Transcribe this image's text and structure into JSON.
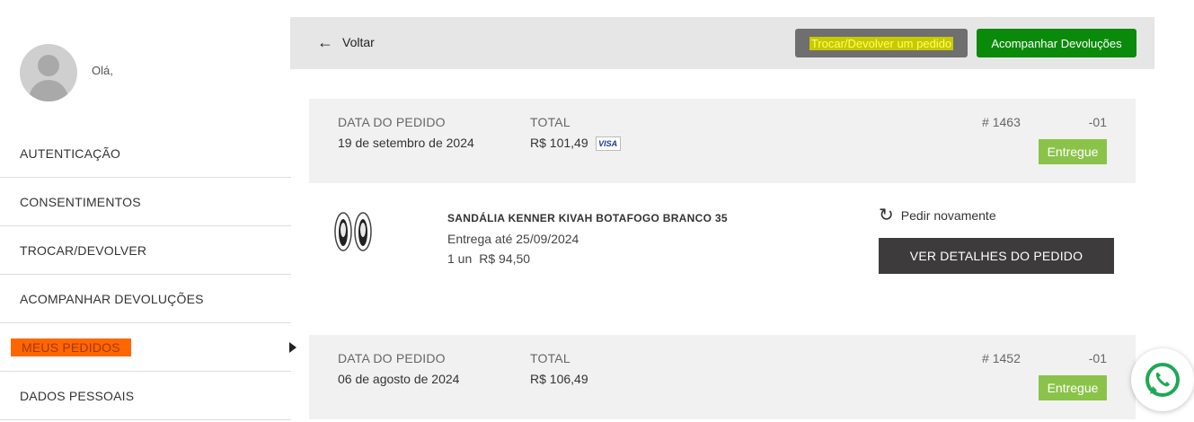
{
  "user": {
    "greeting": "Olá,"
  },
  "sidebar": {
    "items": [
      {
        "label": "AUTENTICAÇÃO"
      },
      {
        "label": "CONSENTIMENTOS"
      },
      {
        "label": "TROCAR/DEVOLVER"
      },
      {
        "label": "ACOMPANHAR DEVOLUÇÕES"
      },
      {
        "label": "MEUS PEDIDOS",
        "active": true
      },
      {
        "label": "DADOS PESSOAIS"
      }
    ]
  },
  "topbar": {
    "back_label": "Voltar",
    "trocar_label": "Trocar/Devolver um pedido",
    "acompanhar_label": "Acompanhar Devoluções"
  },
  "orders": [
    {
      "date_label": "DATA DO PEDIDO",
      "date": "19 de setembro de 2024",
      "total_label": "TOTAL",
      "total": "R$ 101,49",
      "payment": "VISA",
      "number": "# 1463",
      "suffix": "-01",
      "status": "Entregue",
      "item": {
        "name": "SANDÁLIA KENNER KIVAH BOTAFOGO BRANCO 35",
        "delivery": "Entrega até 25/09/2024",
        "qty": "1 un",
        "price": "R$ 94,50"
      },
      "reorder_label": "Pedir novamente",
      "details_label": "VER DETALHES DO PEDIDO"
    },
    {
      "date_label": "DATA DO PEDIDO",
      "date": "06 de agosto de 2024",
      "total_label": "TOTAL",
      "total": "R$ 106,49",
      "number": "# 1452",
      "suffix": "-01",
      "status": "Entregue"
    }
  ],
  "colors": {
    "active_menu": "#ff6600",
    "status_badge": "#8bc34a",
    "acompanhar_button": "#0a8a0a",
    "whatsapp": "#25d366"
  }
}
